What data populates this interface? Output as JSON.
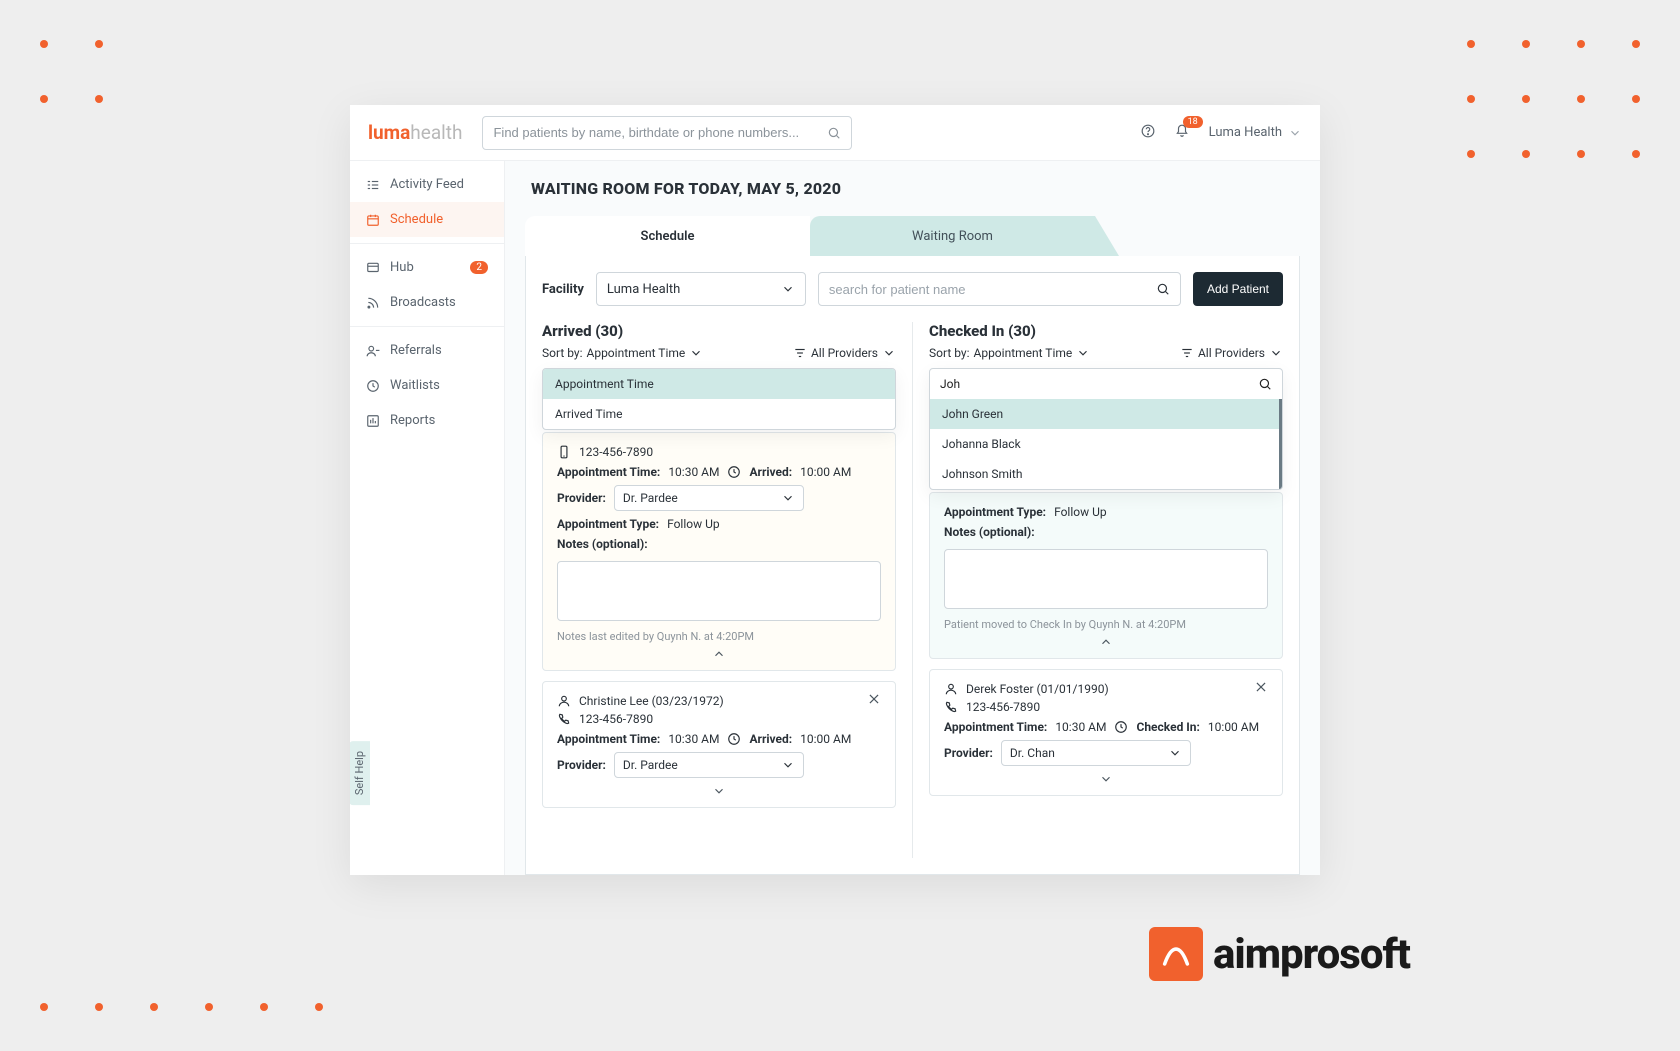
{
  "brand": {
    "luma": "luma",
    "health": "health"
  },
  "topbar": {
    "search_placeholder": "Find patients by name, birthdate or phone numbers...",
    "notification_count": "18",
    "account_label": "Luma Health"
  },
  "sidebar": {
    "items": [
      {
        "label": "Activity Feed"
      },
      {
        "label": "Schedule"
      },
      {
        "label": "Hub",
        "badge": "2"
      },
      {
        "label": "Broadcasts"
      },
      {
        "label": "Referrals"
      },
      {
        "label": "Waitlists"
      },
      {
        "label": "Reports"
      }
    ],
    "self_help": "Self Help"
  },
  "page": {
    "title": "WAITING ROOM FOR TODAY, MAY 5, 2020"
  },
  "tabs": {
    "schedule": "Schedule",
    "waiting_room": "Waiting Room"
  },
  "facility": {
    "label": "Facility",
    "value": "Luma Health",
    "patient_search_placeholder": "search for patient name",
    "add_patient": "Add Patient"
  },
  "columns": {
    "sort_by_label": "Sort by:",
    "sort_value": "Appointment Time",
    "providers_filter": "All Providers",
    "arrived": {
      "title": "Arrived  (30)",
      "sort_options": [
        "Appointment Time",
        "Arrived Time"
      ]
    },
    "checked_in": {
      "title": "Checked In  (30)",
      "search_value": "Joh",
      "suggestions": [
        "John Green",
        "Johanna Black",
        "Johnson Smith"
      ]
    }
  },
  "cards": {
    "arrived_expanded": {
      "phone": "123-456-7890",
      "appt_time_label": "Appointment Time:",
      "appt_time": "10:30 AM",
      "arrived_label": "Arrived:",
      "arrived_time": "10:00 AM",
      "provider_label": "Provider:",
      "provider_value": "Dr. Pardee",
      "appt_type_label": "Appointment Type:",
      "appt_type": "Follow Up",
      "notes_label": "Notes (optional):",
      "foot": "Notes last edited by Quynh N. at 4:20PM"
    },
    "arrived_second": {
      "name": "Christine Lee (03/23/1972)",
      "phone": "123-456-7890",
      "appt_time_label": "Appointment Time:",
      "appt_time": "10:30 AM",
      "arrived_label": "Arrived:",
      "arrived_time": "10:00 AM",
      "provider_label": "Provider:",
      "provider_value": "Dr. Pardee"
    },
    "checked_expanded": {
      "appt_type_label": "Appointment Type:",
      "appt_type": "Follow Up",
      "notes_label": "Notes (optional):",
      "foot": "Patient moved to Check In by Quynh N. at 4:20PM"
    },
    "checked_second": {
      "name": "Derek Foster (01/01/1990)",
      "phone": "123-456-7890",
      "appt_time_label": "Appointment Time:",
      "appt_time": "10:30 AM",
      "checked_label": "Checked In:",
      "checked_time": "10:00 AM",
      "provider_label": "Provider:",
      "provider_value": "Dr. Chan"
    }
  },
  "watermark": {
    "text": "aimprosoft"
  },
  "colors": {
    "accent": "#f1612d",
    "teal": "#cfe9e6",
    "dark": "#1d2a33"
  }
}
